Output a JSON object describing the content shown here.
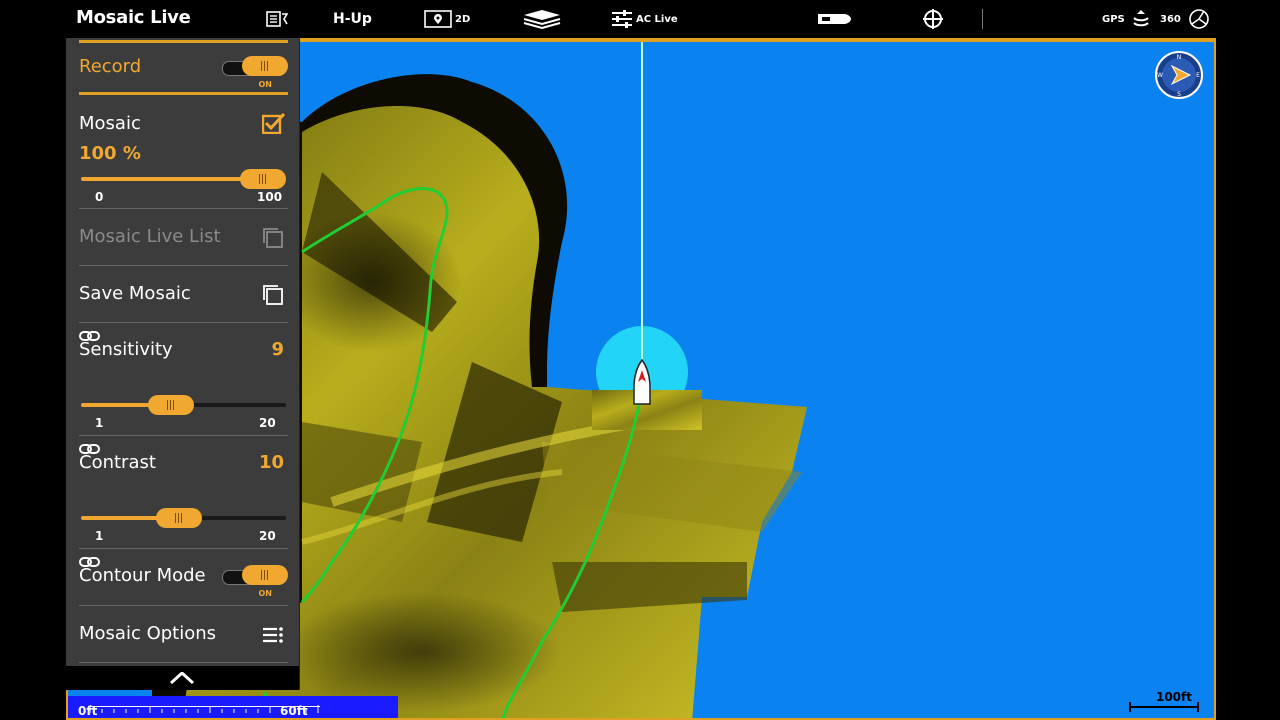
{
  "topbar": {
    "title": "Mosaic Live",
    "orientation": "H-Up",
    "view_mode": "2D",
    "source": "AC Live",
    "gps": "GPS",
    "sonar_360": "360"
  },
  "menu": {
    "record": {
      "label": "Record",
      "state": "ON"
    },
    "mosaic": {
      "label": "Mosaic",
      "checked": true,
      "percent": "100 %",
      "level": 100,
      "min": "0",
      "max": "100"
    },
    "live_list": {
      "label": "Mosaic Live List"
    },
    "save": {
      "label": "Save Mosaic"
    },
    "sensitivity": {
      "label": "Sensitivity",
      "value": "9",
      "level": 9,
      "min": "1",
      "max": "20"
    },
    "contrast": {
      "label": "Contrast",
      "value": "10",
      "level": 10,
      "min": "1",
      "max": "20"
    },
    "contour": {
      "label": "Contour Mode",
      "state": "ON"
    },
    "options": {
      "label": "Mosaic Options"
    }
  },
  "map": {
    "scale_right": "100ft",
    "scale_bottom_start": "0ft",
    "scale_bottom_end": "60ft"
  },
  "colors": {
    "accent": "#f0a830",
    "water": "#0a82f0",
    "track": "#22cc33",
    "mosaic": "#c8b820"
  }
}
